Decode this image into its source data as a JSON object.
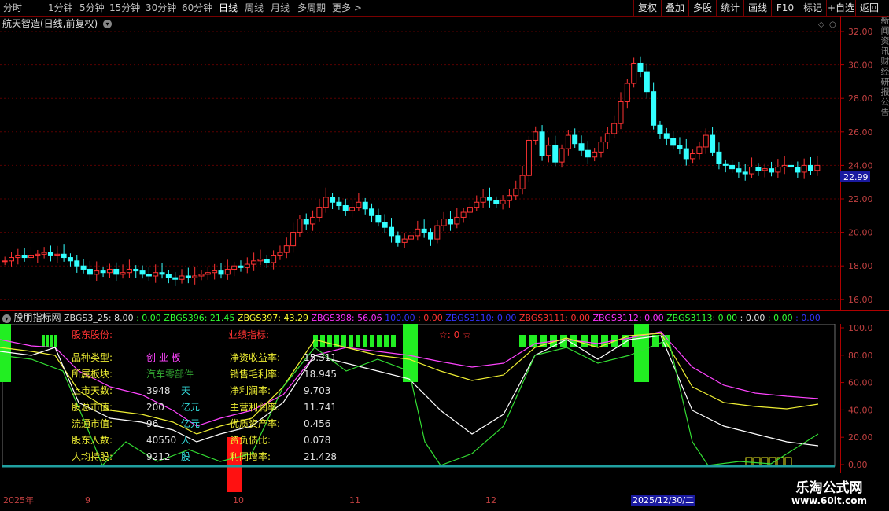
{
  "toolbar": {
    "periods": [
      "分时",
      "1分钟",
      "5分钟",
      "15分钟",
      "30分钟",
      "60分钟",
      "日线",
      "周线",
      "月线",
      "多周期",
      "更多 >"
    ],
    "active_period": "日线",
    "buttons": [
      "复权",
      "叠加",
      "多股",
      "统计",
      "画线",
      "F10",
      "标记",
      "+自选",
      "返回"
    ]
  },
  "main_pane": {
    "title": "航天智造(日线,前复权)",
    "price_axis": [
      "32.00",
      "30.00",
      "28.00",
      "26.00",
      "24.00",
      "22.00",
      "20.00",
      "18.00",
      "16.00"
    ],
    "last_price": "22.99",
    "colors": {
      "up": "#ff3333",
      "down": "#33ffff",
      "grid": "#800000",
      "price_tag": "#1a1aa0"
    }
  },
  "indicator_bar": {
    "name": "股朋指标网",
    "items": [
      {
        "text": "ZBGS3_25: 8.00",
        "color": "#e0e0e0"
      },
      {
        "text": " : 0.00",
        "color": "#33ff33"
      },
      {
        "text": " ZBGS396: 21.45",
        "color": "#33ff33"
      },
      {
        "text": " ZBGS397: 43.29",
        "color": "#ffff33"
      },
      {
        "text": " ZBGS398: 56.06",
        "color": "#ff33ff"
      },
      {
        "text": "   100.00",
        "color": "#3333ff"
      },
      {
        "text": " : 0.00",
        "color": "#ff3333"
      },
      {
        "text": " ZBGS3110: 0.00",
        "color": "#3333ff"
      },
      {
        "text": " ZBGS3111: 0.00",
        "color": "#ff3333"
      },
      {
        "text": " ZBGS3112: 0.00",
        "color": "#ff33ff"
      },
      {
        "text": " ZBGS3113: 0.00",
        "color": "#33ff33"
      },
      {
        "text": " : 0.00",
        "color": "#e0e0e0"
      },
      {
        "text": " : 0.00",
        "color": "#33ff33"
      },
      {
        "text": " : 0.00",
        "color": "#3333ff"
      }
    ]
  },
  "indicator_pane": {
    "axis": [
      "100.0",
      "80.00",
      "60.00",
      "40.00",
      "20.00",
      "0.00"
    ],
    "shareholder_title": "股东股份:",
    "performance_title": "业绩指标:",
    "stars": "☆: 0 ☆",
    "left_rows": [
      {
        "label": "品种类型:",
        "value": "创 业 板",
        "unit": ""
      },
      {
        "label": "所属板块:",
        "value": "汽车零部件",
        "unit": ""
      },
      {
        "label": "上市天数:",
        "value": "3948",
        "unit": "天"
      },
      {
        "label": "股总市值:",
        "value": "200",
        "unit": "亿元"
      },
      {
        "label": "流通市值:",
        "value": "96",
        "unit": "亿元"
      },
      {
        "label": "股东人数:",
        "value": "40550",
        "unit": "人"
      },
      {
        "label": "人均持股:",
        "value": "9212",
        "unit": "股"
      }
    ],
    "right_rows": [
      {
        "label": "净资收益率:",
        "value": "15.311"
      },
      {
        "label": "销售毛利率:",
        "value": "18.945"
      },
      {
        "label": "净利润率:",
        "value": "9.703"
      },
      {
        "label": "主营利润率:",
        "value": "11.741"
      },
      {
        "label": "优质资产率:",
        "value": "0.456"
      },
      {
        "label": "资负债比:",
        "value": "0.078"
      },
      {
        "label": "利同增率:",
        "value": "21.428"
      }
    ]
  },
  "date_axis": {
    "labels": [
      "2025年",
      "9",
      "10",
      "11",
      "12"
    ],
    "highlight": "2025/12/30/二"
  },
  "right_strip": {
    "text": "新闻资讯财经研报公告"
  },
  "watermark": {
    "line1": "乐淘公式网",
    "line2": "www.60lt.com"
  }
}
